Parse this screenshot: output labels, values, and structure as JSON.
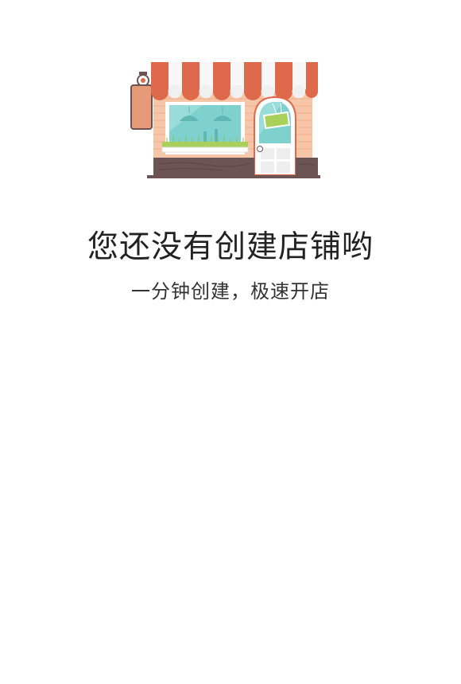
{
  "empty_state": {
    "illustration_icon": "storefront-icon",
    "title": "您还没有创建店铺哟",
    "subtitle": "一分钟创建，极速开店"
  },
  "colors": {
    "awning_red": "#de6a4b",
    "wall_peach": "#f6c6a8",
    "window_teal": "#7fd1ce",
    "base_brown": "#6b5453",
    "sign_green": "#a8d05a"
  }
}
